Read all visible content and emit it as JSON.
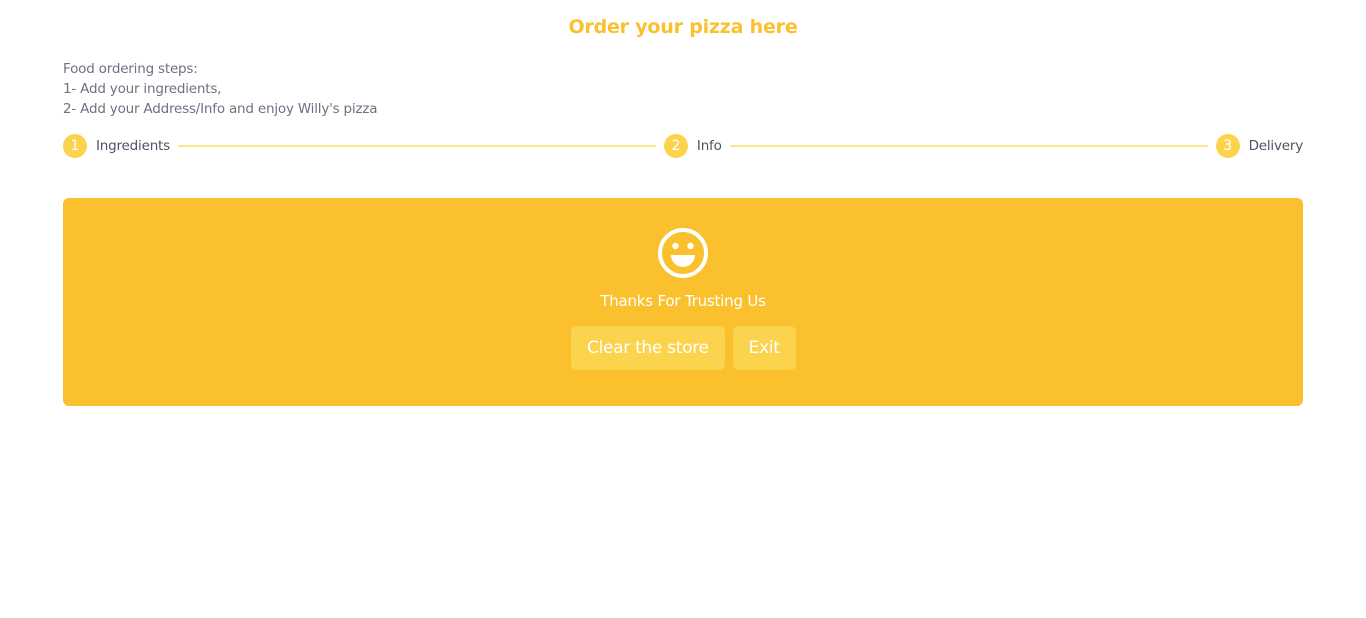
{
  "page": {
    "title": "Order your pizza here"
  },
  "instructions": {
    "heading": "Food ordering steps:",
    "step1": "1- Add your ingredients,",
    "step2": "2- Add your Address/Info and enjoy Willy's pizza"
  },
  "stepper": {
    "steps": [
      {
        "number": "1",
        "label": "Ingredients"
      },
      {
        "number": "2",
        "label": "Info"
      },
      {
        "number": "3",
        "label": "Delivery"
      }
    ]
  },
  "confirmation": {
    "icon": "smiley-face-icon",
    "message": "Thanks For Trusting Us",
    "clear_label": "Clear the store",
    "exit_label": "Exit"
  },
  "colors": {
    "accent": "#fbc02d",
    "accent_light": "#fcd34d",
    "connector": "#fde68a",
    "text_muted": "#6b7280"
  }
}
